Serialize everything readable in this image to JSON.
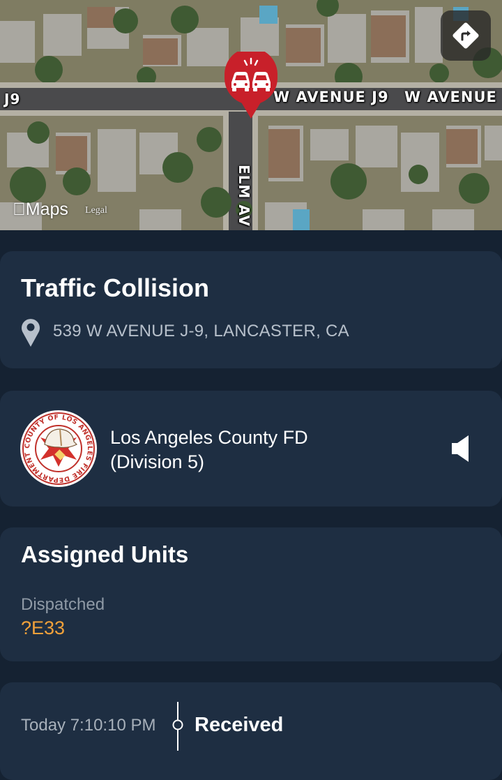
{
  "map": {
    "road_left": "J9",
    "road_right_1": "W AVENUE J9",
    "road_right_2": "W AVENUE",
    "road_cross": "ELM AV",
    "maps_brand": "Maps",
    "legal_label": "Legal",
    "directions_icon": "directions-arrow-icon",
    "pin_icon": "car-collision-icon",
    "pin_color": "#c8202a"
  },
  "incident": {
    "title": "Traffic Collision",
    "address": "539 W AVENUE J-9, LANCASTER, CA",
    "location_icon": "location-pin-icon"
  },
  "agency": {
    "name_line1": "Los Angeles County FD",
    "name_line2": "(Division 5)",
    "seal_text": "COUNTY OF LOS ANGELES FIRE DEPARTMENT",
    "audio_icon": "speaker-icon"
  },
  "units": {
    "title": "Assigned Units",
    "status": "Dispatched",
    "code": "?E33",
    "code_color": "#f2a13a"
  },
  "timeline": {
    "time": "Today 7:10:10 PM",
    "event": "Received"
  }
}
